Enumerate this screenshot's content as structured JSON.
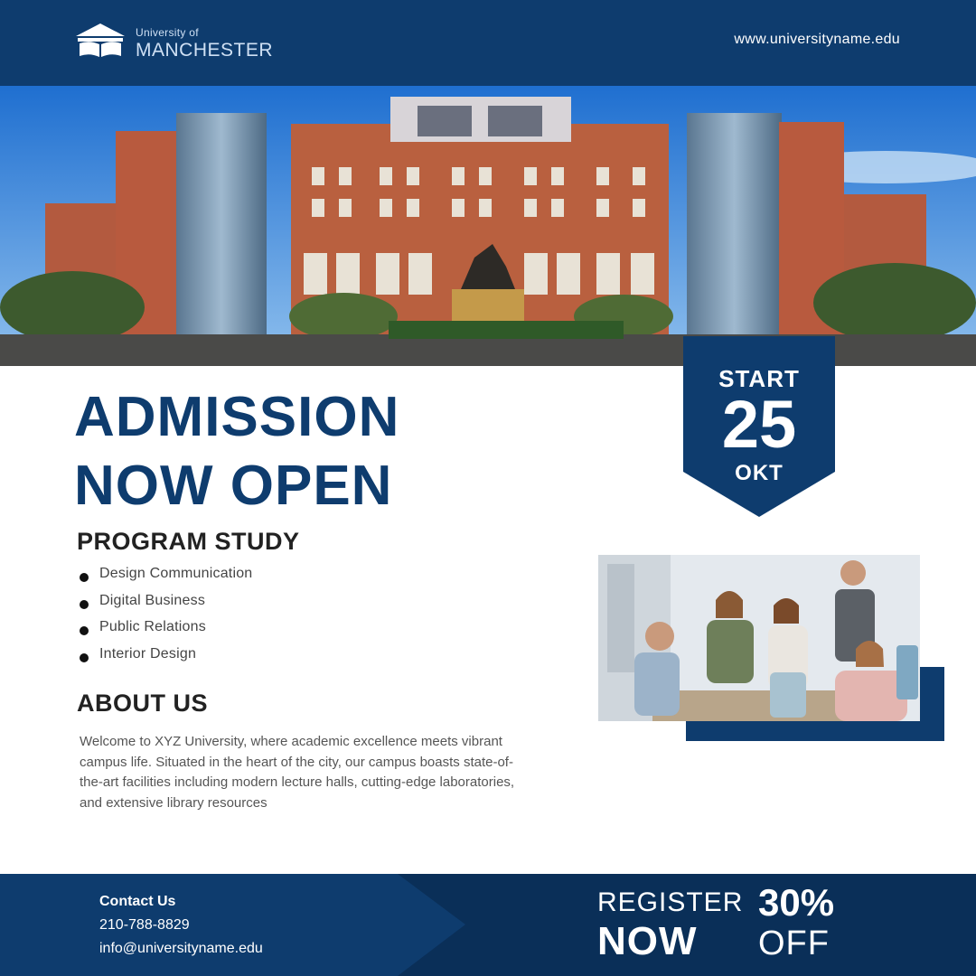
{
  "header": {
    "logo_small": "University of",
    "logo_big": "MANCHESTER",
    "website": "www.universityname.edu"
  },
  "badge": {
    "start_label": "START",
    "day": "25",
    "month": "OKT"
  },
  "headline": {
    "line1": "ADMISSION",
    "line2": "NOW OPEN"
  },
  "program": {
    "title": "PROGRAM STUDY",
    "items": [
      "Design Communication",
      "Digital Business",
      "Public Relations",
      "Interior Design"
    ]
  },
  "about": {
    "title": "ABOUT US",
    "text": "Welcome to XYZ University, where academic excellence meets vibrant campus life. Situated in the heart of the city, our campus boasts state-of-the-art facilities including modern lecture halls, cutting-edge laboratories, and extensive library resources"
  },
  "footer": {
    "contact_title": "Contact Us",
    "phone": "210-788-8829",
    "email": "info@universityname.edu",
    "register": "REGISTER",
    "now": "NOW",
    "discount": "30%",
    "off": "OFF"
  },
  "colors": {
    "brand_navy": "#0e3c6e",
    "footer_dark": "#0a2f58"
  }
}
